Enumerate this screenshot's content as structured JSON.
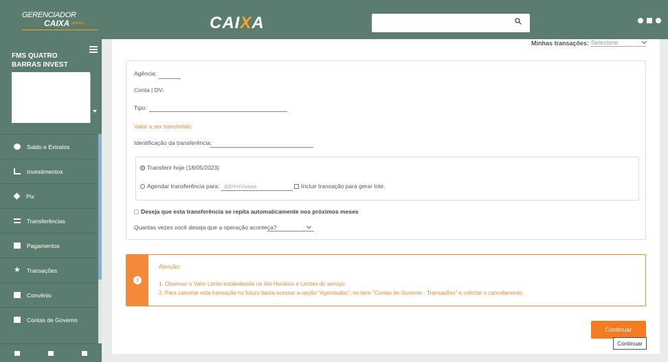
{
  "header": {
    "brand_line1": "GERENCIADOR",
    "brand_line2": "CAIXA",
    "brand_line3": "governo",
    "logo_prefix": "CAI",
    "logo_x": "X",
    "logo_suffix": "A",
    "search_placeholder": ""
  },
  "sidebar": {
    "org_name": "FMS QUATRO BARRAS INVEST",
    "items": [
      {
        "label": "Saldo e Extratos",
        "icon": "coin-icon"
      },
      {
        "label": "Investimentos",
        "icon": "chart-icon"
      },
      {
        "label": "Pix",
        "icon": "pix-icon"
      },
      {
        "label": "Transferências",
        "icon": "transfer-arrows-icon"
      },
      {
        "label": "Pagamentos",
        "icon": "barcode-icon"
      },
      {
        "label": "Transações",
        "icon": "star-icon"
      },
      {
        "label": "Convênio",
        "icon": "plus-square-icon"
      },
      {
        "label": "Contas de Governo",
        "icon": "bank-icon"
      }
    ]
  },
  "main": {
    "my_transactions_label": "Minhas transações:",
    "my_transactions_value": "Selecione",
    "form": {
      "agencia_label": "Agência:",
      "conta_label": "Conta | DV:",
      "tipo_label": "Tipo:",
      "valor_label": "Valor a ser transferido:",
      "ident_label": "Identificação da transferência:",
      "transferir_hoje": "Transferir hoje (18/05/2023)",
      "agendar_label": "Agendar transferência para:",
      "date_placeholder": "dd/mm/aaaa",
      "incluir_lote": "Incluir transação para gerar lote.",
      "repetir_label": "Deseja que esta transferência se repita automaticamente nos próximos meses",
      "quantas_label": "Quantas vezes você deseja que a operação aconteça?"
    },
    "alert": {
      "title": "Atenção:",
      "line1": "1. Observar o Valor Limite estabelecido no link Horários e Limites do serviço.",
      "line2": "2. Para cancelar esta transação no futuro basta acessar a opção \"Agendados\", no item \"Contas de Governo - Transações\" e solicitar o cancelamento."
    },
    "continue_button": "Continuar",
    "tooltip": "Continuar"
  },
  "colors": {
    "sidebar_bg": "#5b7d70",
    "accent_orange": "#f47b20"
  }
}
